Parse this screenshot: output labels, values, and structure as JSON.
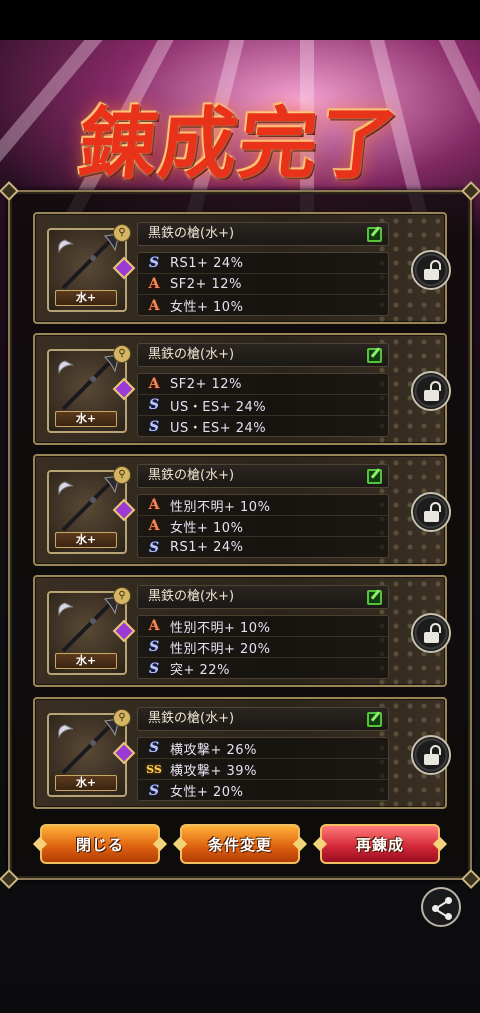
{
  "screen": {
    "title": "錬成完了",
    "accent_color": "#e8321a"
  },
  "weapons": [
    {
      "name": "黒鉄の槍(水+)",
      "element_label": "水+",
      "stats": [
        {
          "icon": "S",
          "text": "RS1+ 24%"
        },
        {
          "icon": "A",
          "text": "SF2+ 12%"
        },
        {
          "icon": "A",
          "text": "女性+ 10%"
        }
      ]
    },
    {
      "name": "黒鉄の槍(水+)",
      "element_label": "水+",
      "stats": [
        {
          "icon": "A",
          "text": "SF2+ 12%"
        },
        {
          "icon": "S",
          "text": "US・ES+ 24%"
        },
        {
          "icon": "S",
          "text": "US・ES+ 24%"
        }
      ]
    },
    {
      "name": "黒鉄の槍(水+)",
      "element_label": "水+",
      "stats": [
        {
          "icon": "A",
          "text": "性別不明+ 10%"
        },
        {
          "icon": "A",
          "text": "女性+ 10%"
        },
        {
          "icon": "S",
          "text": "RS1+ 24%"
        }
      ]
    },
    {
      "name": "黒鉄の槍(水+)",
      "element_label": "水+",
      "stats": [
        {
          "icon": "A",
          "text": "性別不明+ 10%"
        },
        {
          "icon": "S",
          "text": "性別不明+ 20%"
        },
        {
          "icon": "S",
          "text": "突+ 22%"
        }
      ]
    },
    {
      "name": "黒鉄の槍(水+)",
      "element_label": "水+",
      "stats": [
        {
          "icon": "S",
          "text": "横攻撃+ 26%"
        },
        {
          "icon": "SS",
          "text": "横攻撃+ 39%"
        },
        {
          "icon": "S",
          "text": "女性+ 20%"
        }
      ]
    }
  ],
  "buttons": {
    "close": "閉じる",
    "change_conditions": "条件変更",
    "re_refine": "再錬成"
  },
  "icons": {
    "lock": "unlock-icon",
    "edit": "edit-icon",
    "share": "share-icon",
    "rank_A": "A",
    "rank_S": "S",
    "rank_SS": "SS"
  }
}
